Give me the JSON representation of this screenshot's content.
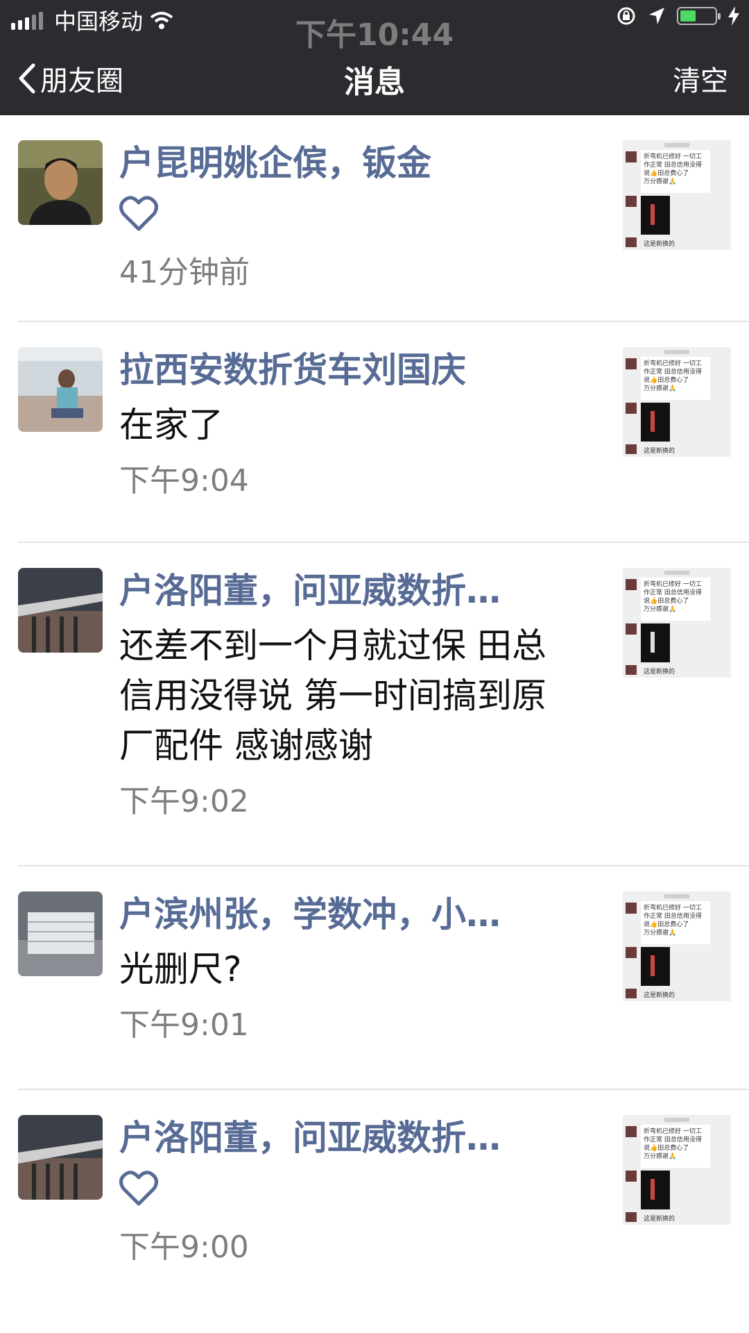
{
  "status_bar": {
    "carrier": "中国移动",
    "time": "下午10:44",
    "battery_color": "#4cd964"
  },
  "nav": {
    "back_label": "朋友圈",
    "title": "消息",
    "clear_label": "清空"
  },
  "colors": {
    "name": "#576b95",
    "time": "#7d7d7d",
    "nav_bg": "#2c2c30"
  },
  "thumbnail": {
    "text": "折弯机已修好 一切工作正常 田总信用没得说👍👍👍田总费心了 万分感谢🙏",
    "caption": "这是新换的"
  },
  "messages": [
    {
      "name": "户昆明姚企傧，钣金",
      "type": "like",
      "text": "",
      "time": "41分钟前",
      "avatar": "portrait-man"
    },
    {
      "name": "拉西安数折货车刘国庆",
      "type": "comment",
      "text": "在家了",
      "time": "下午9:04",
      "avatar": "boy-on-sofa"
    },
    {
      "name": "户洛阳董，问亚威数折…",
      "type": "comment",
      "text": "还差不到一个月就过保 田总信用没得说 第一时间搞到原厂配件 感谢感谢",
      "time": "下午9:02",
      "avatar": "machine"
    },
    {
      "name": "户滨州张，学数冲，小…",
      "type": "comment",
      "text": "光删尺?",
      "time": "下午9:01",
      "avatar": "shelves"
    },
    {
      "name": "户洛阳董，问亚威数折…",
      "type": "like",
      "text": "",
      "time": "下午9:00",
      "avatar": "machine"
    }
  ]
}
